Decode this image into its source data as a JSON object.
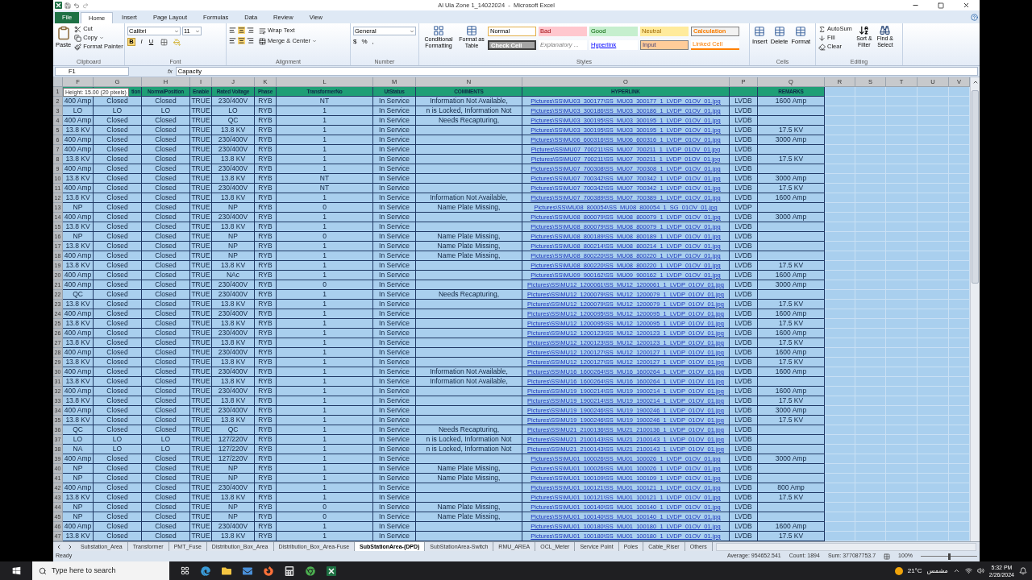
{
  "window": {
    "title": "Al Ula Zone 1_14022024  -  Microsoft Excel"
  },
  "ribbon_tabs": [
    {
      "label": "File",
      "kind": "file",
      "selected": false
    },
    {
      "label": "Home",
      "kind": "tab",
      "selected": true
    },
    {
      "label": "Insert",
      "kind": "tab",
      "selected": false
    },
    {
      "label": "Page Layout",
      "kind": "tab",
      "selected": false
    },
    {
      "label": "Formulas",
      "kind": "tab",
      "selected": false
    },
    {
      "label": "Data",
      "kind": "tab",
      "selected": false
    },
    {
      "label": "Review",
      "kind": "tab",
      "selected": false
    },
    {
      "label": "View",
      "kind": "tab",
      "selected": false
    }
  ],
  "ribbon": {
    "clipboard": {
      "label": "Clipboard",
      "paste": "Paste",
      "cut": "Cut",
      "copy": "Copy",
      "format_painter": "Format Painter"
    },
    "font": {
      "label": "Font",
      "font_name": "Calibri",
      "font_size": "11",
      "bold": "B",
      "italic": "I",
      "underline": "U"
    },
    "alignment": {
      "label": "Alignment",
      "wrap_text": "Wrap Text",
      "merge_center": "Merge & Center"
    },
    "number": {
      "label": "Number",
      "format": "General",
      "currency": "$",
      "percent": "%",
      "comma": ","
    },
    "styles": {
      "label": "Styles",
      "conditional_formatting": "Conditional Formatting",
      "format_as_table": "Format as Table",
      "gallery": [
        {
          "label": "Normal",
          "kind": "normal"
        },
        {
          "label": "Bad",
          "kind": "bad"
        },
        {
          "label": "Good",
          "kind": "good"
        },
        {
          "label": "Neutral",
          "kind": "neutral"
        },
        {
          "label": "Calculation",
          "kind": "calculation"
        },
        {
          "label": "Check Cell",
          "kind": "check"
        },
        {
          "label": "Explanatory ...",
          "kind": "explanatory"
        },
        {
          "label": "Hyperlink",
          "kind": "hyperlink"
        },
        {
          "label": "Input",
          "kind": "input"
        },
        {
          "label": "Linked Cell",
          "kind": "linked"
        }
      ]
    },
    "cells": {
      "label": "Cells",
      "insert": "Insert",
      "delete": "Delete",
      "format": "Format"
    },
    "editing": {
      "label": "Editing",
      "autosum": "AutoSum",
      "fill": "Fill",
      "clear": "Clear",
      "sort_filter": "Sort & Filter",
      "find_select": "Find & Select"
    }
  },
  "formula_bar": {
    "name_box": "F1",
    "fx": "fx",
    "value": "Capacity"
  },
  "tooltip": "Height: 15.00 (20 pixels)",
  "columns": [
    {
      "letter": "F",
      "kind": "text"
    },
    {
      "letter": "G",
      "kind": "text"
    },
    {
      "letter": "H",
      "kind": "text"
    },
    {
      "letter": "I",
      "kind": "text"
    },
    {
      "letter": "J",
      "kind": "text"
    },
    {
      "letter": "K",
      "kind": "text"
    },
    {
      "letter": "L",
      "kind": "text"
    },
    {
      "letter": "M",
      "kind": "text"
    },
    {
      "letter": "N",
      "kind": "text"
    },
    {
      "letter": "O",
      "kind": "link"
    },
    {
      "letter": "P",
      "kind": "text"
    },
    {
      "letter": "Q",
      "kind": "text"
    },
    {
      "letter": "R",
      "kind": "blank"
    },
    {
      "letter": "S",
      "kind": "blank"
    },
    {
      "letter": "T",
      "kind": "blank"
    },
    {
      "letter": "U",
      "kind": "blank"
    },
    {
      "letter": "V",
      "kind": "blank"
    }
  ],
  "header_row": {
    "n": "1",
    "G": "tion",
    "H": "NormalPosition",
    "I": "Enable",
    "J": "Rated Voltage",
    "K": "Phase",
    "L": "TransformerNo",
    "M": "UtStatus",
    "N": "COMMENTS",
    "O": "HYPERLINK",
    "Q": "REMARKS"
  },
  "rows": [
    {
      "n": "2",
      "F": "400 Amp",
      "G": "Closed",
      "H": "Closed",
      "I": "TRUE",
      "J": "230/400V",
      "K": "RYB",
      "L": "NT",
      "M": "In Service",
      "N": "Information Not Available,",
      "O": "Pictures\\SS\\MU03_300177\\SS_MU03_300177_1_LVDP_01OV_01.jpg",
      "P": "LVDB",
      "Q": "1600 Amp"
    },
    {
      "n": "3",
      "F": "LO",
      "G": "LO",
      "H": "LO",
      "I": "TRUE",
      "J": "LO",
      "K": "RYB",
      "L": "1",
      "M": "In Service",
      "N": "n is Locked, Information Not",
      "O": "Pictures\\SS\\MU03_300186\\SS_MU03_300186_1_LVDP_01OV_01.jpg",
      "P": "LVDB"
    },
    {
      "n": "4",
      "F": "400 Amp",
      "G": "Closed",
      "H": "Closed",
      "I": "TRUE",
      "J": "QC",
      "K": "RYB",
      "L": "1",
      "M": "In Service",
      "N": "Needs Recapturing,",
      "O": "Pictures\\SS\\MU03_300195\\SS_MU03_300195_1_LVDP_01OV_01.jpg",
      "P": "LVDB"
    },
    {
      "n": "5",
      "F": "13.8 KV",
      "G": "Closed",
      "H": "Closed",
      "I": "TRUE",
      "J": "13.8 KV",
      "K": "RYB",
      "L": "1",
      "M": "In Service",
      "O": "Pictures\\SS\\MU03_300195\\SS_MU03_300195_1_LVDP_01OV_01.jpg",
      "P": "LVDB",
      "Q": "17.5 KV"
    },
    {
      "n": "6",
      "F": "400 Amp",
      "G": "Closed",
      "H": "Closed",
      "I": "TRUE",
      "J": "230/400V",
      "K": "RYB",
      "L": "1",
      "M": "In Service",
      "O": "Pictures\\SS\\MU06_600316\\SS_MU06_600316_1_LVDP_01OV_01.jpg",
      "P": "LVDB",
      "Q": "3000 Amp"
    },
    {
      "n": "7",
      "F": "400 Amp",
      "G": "Closed",
      "H": "Closed",
      "I": "TRUE",
      "J": "230/400V",
      "K": "RYB",
      "L": "1",
      "M": "In Service",
      "O": "Pictures\\SS\\MU07_700211\\SS_MU07_700211_1_LVDP_01OV_01.jpg",
      "P": "LVDB"
    },
    {
      "n": "8",
      "F": "13.8 KV",
      "G": "Closed",
      "H": "Closed",
      "I": "TRUE",
      "J": "13.8 KV",
      "K": "RYB",
      "L": "1",
      "M": "In Service",
      "O": "Pictures\\SS\\MU07_700211\\SS_MU07_700211_1_LVDP_01OV_01.jpg",
      "P": "LVDB",
      "Q": "17.5 KV"
    },
    {
      "n": "9",
      "F": "400 Amp",
      "G": "Closed",
      "H": "Closed",
      "I": "TRUE",
      "J": "230/400V",
      "K": "RYB",
      "L": "1",
      "M": "In Service",
      "O": "Pictures\\SS\\MU07_700308\\SS_MU07_700308_1_LVDP_01OV_01.jpg",
      "P": "LVDB"
    },
    {
      "n": "10",
      "F": "13.8 KV",
      "G": "Closed",
      "H": "Closed",
      "I": "TRUE",
      "J": "13.8 KV",
      "K": "RYB",
      "L": "NT",
      "M": "In Service",
      "O": "Pictures\\SS\\MU07_700342\\SS_MU07_700342_1_LVDP_01OV_01.jpg",
      "P": "LVDB",
      "Q": "3000 Amp"
    },
    {
      "n": "11",
      "F": "400 Amp",
      "G": "Closed",
      "H": "Closed",
      "I": "TRUE",
      "J": "230/400V",
      "K": "RYB",
      "L": "NT",
      "M": "In Service",
      "O": "Pictures\\SS\\MU07_700342\\SS_MU07_700342_1_LVDP_01OV_01.jpg",
      "P": "LVDB",
      "Q": "17.5 KV"
    },
    {
      "n": "12",
      "F": "13.8 KV",
      "G": "Closed",
      "H": "Closed",
      "I": "TRUE",
      "J": "13.8 KV",
      "K": "RYB",
      "L": "1",
      "M": "In Service",
      "N": "Information Not Available,",
      "O": "Pictures\\SS\\MU07_700389\\SS_MU07_700389_1_LVDP_01OV_01.jpg",
      "P": "LVDB",
      "Q": "1600 Amp"
    },
    {
      "n": "13",
      "F": "NP",
      "G": "Closed",
      "H": "Closed",
      "I": "TRUE",
      "J": "NP",
      "K": "RYB",
      "L": "0",
      "M": "In Service",
      "N": "Name Plate Missing,",
      "O": "Pictures\\SS\\MU08_800054\\SS_MU08_800054_1_SG_01OV_01.jpg",
      "P": "LVDP"
    },
    {
      "n": "14",
      "F": "400 Amp",
      "G": "Closed",
      "H": "Closed",
      "I": "TRUE",
      "J": "230/400V",
      "K": "RYB",
      "L": "1",
      "M": "In Service",
      "O": "Pictures\\SS\\MU08_800079\\SS_MU08_800079_1_LVDP_01OV_01.jpg",
      "P": "LVDB",
      "Q": "3000 Amp"
    },
    {
      "n": "15",
      "F": "13.8 KV",
      "G": "Closed",
      "H": "Closed",
      "I": "TRUE",
      "J": "13.8 KV",
      "K": "RYB",
      "L": "1",
      "M": "In Service",
      "O": "Pictures\\SS\\MU08_800079\\SS_MU08_800079_1_LVDP_01OV_01.jpg",
      "P": "LVDB"
    },
    {
      "n": "16",
      "F": "NP",
      "G": "Closed",
      "H": "Closed",
      "I": "TRUE",
      "J": "NP",
      "K": "RYB",
      "L": "0",
      "M": "In Service",
      "N": "Name Plate Missing,",
      "O": "Pictures\\SS\\MU08_800189\\SS_MU08_800189_1_LVDP_01OV_01.jpg",
      "P": "LVDB"
    },
    {
      "n": "17",
      "F": "13.8 KV",
      "G": "Closed",
      "H": "Closed",
      "I": "TRUE",
      "J": "NP",
      "K": "RYB",
      "L": "1",
      "M": "In Service",
      "N": "Name Plate Missing,",
      "O": "Pictures\\SS\\MU08_800214\\SS_MU08_800214_1_LVDP_01OV_01.jpg",
      "P": "LVDB"
    },
    {
      "n": "18",
      "F": "400 Amp",
      "G": "Closed",
      "H": "Closed",
      "I": "TRUE",
      "J": "NP",
      "K": "RYB",
      "L": "1",
      "M": "In Service",
      "N": "Name Plate Missing,",
      "O": "Pictures\\SS\\MU08_800220\\SS_MU08_800220_1_LVDP_01OV_01.jpg",
      "P": "LVDB"
    },
    {
      "n": "19",
      "F": "13.8 KV",
      "G": "Closed",
      "H": "Closed",
      "I": "TRUE",
      "J": "13.8 KV",
      "K": "RYB",
      "L": "1",
      "M": "In Service",
      "O": "Pictures\\SS\\MU08_800220\\SS_MU08_800220_1_LVDP_01OV_01.jpg",
      "P": "LVDB",
      "Q": "17.5 KV"
    },
    {
      "n": "20",
      "F": "400 Amp",
      "G": "Closed",
      "H": "Closed",
      "I": "TRUE",
      "J": "NAc",
      "K": "RYB",
      "L": "1",
      "M": "In Service",
      "O": "Pictures\\SS\\MU09_900162\\SS_MU09_900162_1_LVDP_01OV_01.jpg",
      "P": "LVDB",
      "Q": "1600 Amp"
    },
    {
      "n": "21",
      "F": "400 Amp",
      "G": "Closed",
      "H": "Closed",
      "I": "TRUE",
      "J": "230/400V",
      "K": "RYB",
      "L": "0",
      "M": "In Service",
      "O": "Pictures\\SS\\MU12_1200061\\SS_MU12_1200061_1_LVDP_01OV_01.jpg",
      "P": "LVDB",
      "Q": "3000 Amp"
    },
    {
      "n": "22",
      "F": "QC",
      "G": "Closed",
      "H": "Closed",
      "I": "TRUE",
      "J": "230/400V",
      "K": "RYB",
      "L": "1",
      "M": "In Service",
      "N": "Needs Recapturing,",
      "O": "Pictures\\SS\\MU12_1200079\\SS_MU12_1200079_1_LVDP_01OV_01.jpg",
      "P": "LVDB"
    },
    {
      "n": "23",
      "F": "13.8 KV",
      "G": "Closed",
      "H": "Closed",
      "I": "TRUE",
      "J": "13.8 KV",
      "K": "RYB",
      "L": "1",
      "M": "In Service",
      "O": "Pictures\\SS\\MU12_1200079\\SS_MU12_1200079_1_LVDP_01OV_01.jpg",
      "P": "LVDB",
      "Q": "17.5 KV"
    },
    {
      "n": "24",
      "F": "400 Amp",
      "G": "Closed",
      "H": "Closed",
      "I": "TRUE",
      "J": "230/400V",
      "K": "RYB",
      "L": "1",
      "M": "In Service",
      "O": "Pictures\\SS\\MU12_1200095\\SS_MU12_1200095_1_LVDP_01OV_01.jpg",
      "P": "LVDB",
      "Q": "1600 Amp"
    },
    {
      "n": "25",
      "F": "13.8 KV",
      "G": "Closed",
      "H": "Closed",
      "I": "TRUE",
      "J": "13.8 KV",
      "K": "RYB",
      "L": "1",
      "M": "In Service",
      "O": "Pictures\\SS\\MU12_1200095\\SS_MU12_1200095_1_LVDP_01OV_01.jpg",
      "P": "LVDB",
      "Q": "17.5 KV"
    },
    {
      "n": "26",
      "F": "400 Amp",
      "G": "Closed",
      "H": "Closed",
      "I": "TRUE",
      "J": "230/400V",
      "K": "RYB",
      "L": "1",
      "M": "In Service",
      "O": "Pictures\\SS\\MU12_1200123\\SS_MU12_1200123_1_LVDP_01OV_01.jpg",
      "P": "LVDB",
      "Q": "1600 Amp"
    },
    {
      "n": "27",
      "F": "13.8 KV",
      "G": "Closed",
      "H": "Closed",
      "I": "TRUE",
      "J": "13.8 KV",
      "K": "RYB",
      "L": "1",
      "M": "In Service",
      "O": "Pictures\\SS\\MU12_1200123\\SS_MU12_1200123_1_LVDP_01OV_01.jpg",
      "P": "LVDB",
      "Q": "17.5 KV"
    },
    {
      "n": "28",
      "F": "400 Amp",
      "G": "Closed",
      "H": "Closed",
      "I": "TRUE",
      "J": "230/400V",
      "K": "RYB",
      "L": "1",
      "M": "In Service",
      "O": "Pictures\\SS\\MU12_1200127\\SS_MU12_1200127_1_LVDP_01OV_01.jpg",
      "P": "LVDB",
      "Q": "1600 Amp"
    },
    {
      "n": "29",
      "F": "13.8 KV",
      "G": "Closed",
      "H": "Closed",
      "I": "TRUE",
      "J": "13.8 KV",
      "K": "RYB",
      "L": "1",
      "M": "In Service",
      "O": "Pictures\\SS\\MU12_1200127\\SS_MU12_1200127_1_LVDP_01OV_01.jpg",
      "P": "LVDB",
      "Q": "17.5 KV"
    },
    {
      "n": "30",
      "F": "400 Amp",
      "G": "Closed",
      "H": "Closed",
      "I": "TRUE",
      "J": "230/400V",
      "K": "RYB",
      "L": "1",
      "M": "In Service",
      "N": "Information Not Available,",
      "O": "Pictures\\SS\\MU16_1600264\\SS_MU16_1600264_1_LVDP_01OV_01.jpg",
      "P": "LVDB",
      "Q": "1600 Amp"
    },
    {
      "n": "31",
      "F": "13.8 KV",
      "G": "Closed",
      "H": "Closed",
      "I": "TRUE",
      "J": "13.8 KV",
      "K": "RYB",
      "L": "1",
      "M": "In Service",
      "N": "Information Not Available,",
      "O": "Pictures\\SS\\MU16_1600264\\SS_MU16_1600264_1_LVDP_01OV_01.jpg",
      "P": "LVDB"
    },
    {
      "n": "32",
      "F": "400 Amp",
      "G": "Closed",
      "H": "Closed",
      "I": "TRUE",
      "J": "230/400V",
      "K": "RYB",
      "L": "1",
      "M": "In Service",
      "O": "Pictures\\SS\\MU19_1900214\\SS_MU19_1900214_1_LVDP_01OV_01.jpg",
      "P": "LVDB",
      "Q": "1600 Amp"
    },
    {
      "n": "33",
      "F": "13.8 KV",
      "G": "Closed",
      "H": "Closed",
      "I": "TRUE",
      "J": "13.8 KV",
      "K": "RYB",
      "L": "1",
      "M": "In Service",
      "O": "Pictures\\SS\\MU19_1900214\\SS_MU19_1900214_1_LVDP_01OV_01.jpg",
      "P": "LVDB",
      "Q": "17.5 KV"
    },
    {
      "n": "34",
      "F": "400 Amp",
      "G": "Closed",
      "H": "Closed",
      "I": "TRUE",
      "J": "230/400V",
      "K": "RYB",
      "L": "1",
      "M": "In Service",
      "O": "Pictures\\SS\\MU19_1900246\\SS_MU19_1900246_1_LVDP_01OV_01.jpg",
      "P": "LVDB",
      "Q": "3000 Amp"
    },
    {
      "n": "35",
      "F": "13.8 KV",
      "G": "Closed",
      "H": "Closed",
      "I": "TRUE",
      "J": "13.8 KV",
      "K": "RYB",
      "L": "1",
      "M": "In Service",
      "O": "Pictures\\SS\\MU19_1900246\\SS_MU19_1900246_1_LVDP_01OV_01.jpg",
      "P": "LVDB",
      "Q": "17.5 KV"
    },
    {
      "n": "36",
      "F": "QC",
      "G": "Closed",
      "H": "Closed",
      "I": "TRUE",
      "J": "QC",
      "K": "RYB",
      "L": "1",
      "M": "In Service",
      "N": "Needs Recapturing,",
      "O": "Pictures\\SS\\MU21_2100136\\SS_MU21_2100136_1_LVDP_01OV_01.jpg",
      "P": "LVDB"
    },
    {
      "n": "37",
      "F": "LO",
      "G": "LO",
      "H": "LO",
      "I": "TRUE",
      "J": "127/220V",
      "K": "RYB",
      "L": "1",
      "M": "In Service",
      "N": "n is Locked, Information Not",
      "O": "Pictures\\SS\\MU21_2100143\\SS_MU21_2100143_1_LVDP_01OV_01.jpg",
      "P": "LVDB"
    },
    {
      "n": "38",
      "F": "NA",
      "G": "LO",
      "H": "LO",
      "I": "TRUE",
      "J": "127/220V",
      "K": "RYB",
      "L": "1",
      "M": "In Service",
      "N": "n is Locked, Information Not",
      "O": "Pictures\\SS\\MU21_2100143\\SS_MU21_2100143_1_LVDP_01OV_01.jpg",
      "P": "LVDB"
    },
    {
      "n": "39",
      "F": "400 Amp",
      "G": "Closed",
      "H": "Closed",
      "I": "TRUE",
      "J": "127/220V",
      "K": "RYB",
      "L": "1",
      "M": "In Service",
      "O": "Pictures\\SS\\MU01_100026\\SS_MU01_100026_1_LVDP_01OV_01.jpg",
      "P": "LVDB",
      "Q": "3000 Amp"
    },
    {
      "n": "40",
      "F": "NP",
      "G": "Closed",
      "H": "Closed",
      "I": "TRUE",
      "J": "NP",
      "K": "RYB",
      "L": "1",
      "M": "In Service",
      "N": "Name Plate Missing,",
      "O": "Pictures\\SS\\MU01_100026\\SS_MU01_100026_1_LVDP_01OV_01.jpg",
      "P": "LVDB"
    },
    {
      "n": "41",
      "F": "NP",
      "G": "Closed",
      "H": "Closed",
      "I": "TRUE",
      "J": "NP",
      "K": "RYB",
      "L": "1",
      "M": "In Service",
      "N": "Name Plate Missing,",
      "O": "Pictures\\SS\\MU01_100109\\SS_MU01_100109_1_LVDP_01OV_01.jpg",
      "P": "LVDB"
    },
    {
      "n": "42",
      "F": "400 Amp",
      "G": "Closed",
      "H": "Closed",
      "I": "TRUE",
      "J": "230/400V",
      "K": "RYB",
      "L": "1",
      "M": "In Service",
      "O": "Pictures\\SS\\MU01_100121\\SS_MU01_100121_1_LVDP_01OV_01.jpg",
      "P": "LVDB",
      "Q": "800 Amp"
    },
    {
      "n": "43",
      "F": "13.8 KV",
      "G": "Closed",
      "H": "Closed",
      "I": "TRUE",
      "J": "13.8 KV",
      "K": "RYB",
      "L": "1",
      "M": "In Service",
      "O": "Pictures\\SS\\MU01_100121\\SS_MU01_100121_1_LVDP_01OV_01.jpg",
      "P": "LVDB",
      "Q": "17.5 KV"
    },
    {
      "n": "44",
      "F": "NP",
      "G": "Closed",
      "H": "Closed",
      "I": "TRUE",
      "J": "NP",
      "K": "RYB",
      "L": "0",
      "M": "In Service",
      "N": "Name Plate Missing,",
      "O": "Pictures\\SS\\MU01_100140\\SS_MU01_100140_1_LVDP_01OV_01.jpg",
      "P": "LVDB"
    },
    {
      "n": "45",
      "F": "NP",
      "G": "Closed",
      "H": "Closed",
      "I": "TRUE",
      "J": "NP",
      "K": "RYB",
      "L": "0",
      "M": "In Service",
      "N": "Name Plate Missing,",
      "O": "Pictures\\SS\\MU01_100140\\SS_MU01_100140_1_LVDP_01OV_01.jpg",
      "P": "LVDB"
    },
    {
      "n": "46",
      "F": "400 Amp",
      "G": "Closed",
      "H": "Closed",
      "I": "TRUE",
      "J": "230/400V",
      "K": "RYB",
      "L": "1",
      "M": "In Service",
      "O": "Pictures\\SS\\MU01_100180\\SS_MU01_100180_1_LVDP_01OV_01.jpg",
      "P": "LVDB",
      "Q": "1600 Amp"
    },
    {
      "n": "47",
      "F": "13.8 KV",
      "G": "Closed",
      "H": "Closed",
      "I": "TRUE",
      "J": "13.8 KV",
      "K": "RYB",
      "L": "1",
      "M": "In Service",
      "O": "Pictures\\SS\\MU01_100180\\SS_MU01_100180_1_LVDP_01OV_01.jpg",
      "P": "LVDB",
      "Q": "17.5 KV"
    }
  ],
  "sheet_tabs": [
    {
      "label": "Substation_Area",
      "selected": false
    },
    {
      "label": "Transformer",
      "selected": false
    },
    {
      "label": "PMT_Fuse",
      "selected": false
    },
    {
      "label": "Distribution_Box_Area",
      "selected": false
    },
    {
      "label": "Distribution_Box_Area-Fuse",
      "selected": false
    },
    {
      "label": "SubStationArea-(DPD)",
      "selected": true
    },
    {
      "label": "SubStationArea-Switch",
      "selected": false
    },
    {
      "label": "RMU_AREA",
      "selected": false
    },
    {
      "label": "OCL_Meter",
      "selected": false
    },
    {
      "label": "Service Point",
      "selected": false
    },
    {
      "label": "Poles",
      "selected": false
    },
    {
      "label": "Cable_Riser",
      "selected": false
    },
    {
      "label": "Others",
      "selected": false
    }
  ],
  "status_bar": {
    "mode": "Ready",
    "average": "Average: 954652.541",
    "count": "Count: 1894",
    "sum": "Sum: 377087753.7",
    "zoom": "100%",
    "zoom_slider": {
      "level": 0.5
    }
  },
  "taskbar": {
    "search_placeholder": "Type here to search",
    "temperature": "21°C",
    "weather": "مشمس",
    "time": "5:32 PM",
    "date": "2/26/2024"
  }
}
